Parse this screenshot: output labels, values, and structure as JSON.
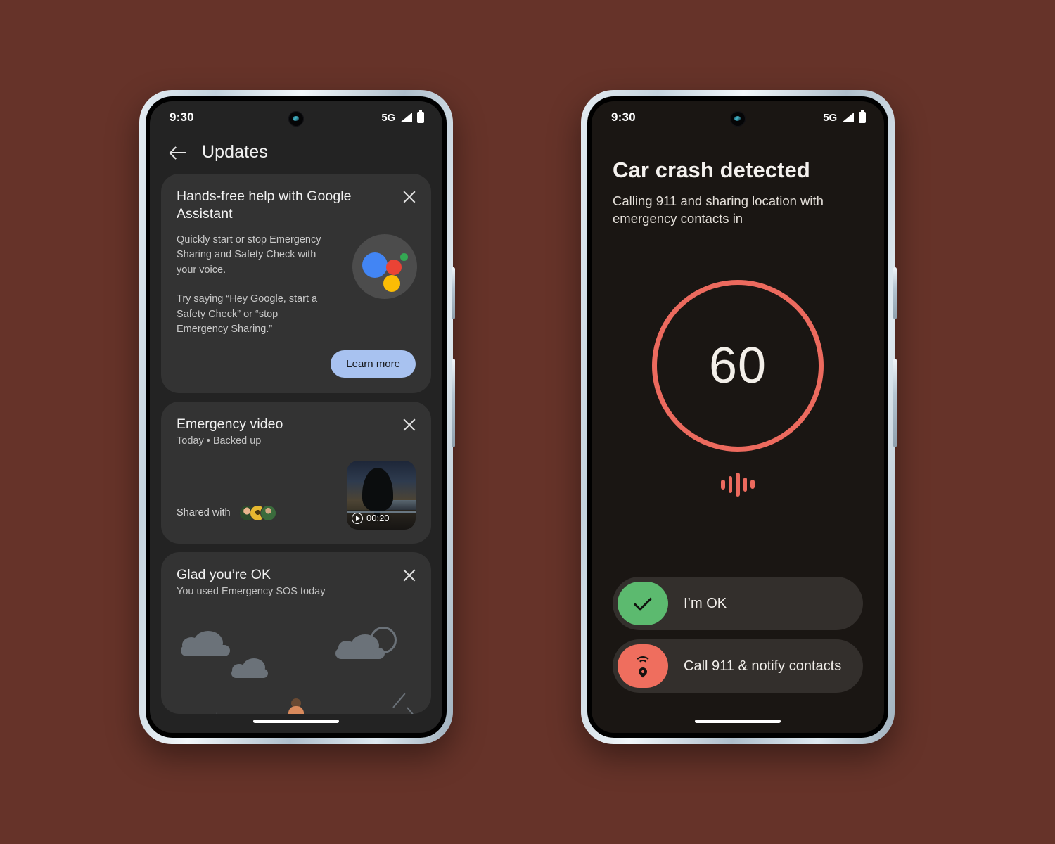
{
  "background_color": "#663329",
  "phones": {
    "left": {
      "status_bar": {
        "time": "9:30",
        "network": "5G",
        "signal_icon": "signal-bars-icon",
        "battery_icon": "battery-full-icon"
      },
      "topbar": {
        "back_icon": "back-arrow-icon",
        "title": "Updates"
      },
      "cards": [
        {
          "id": "assistant",
          "title": "Hands-free help with Google Assistant",
          "close_icon": "close-icon",
          "paragraphs": [
            "Quickly start or stop Emergency Sharing and Safety Check with your voice.",
            "Try saying “Hey Google, start a Safety Check” or “stop Emergency Sharing.”"
          ],
          "orb_icon": "google-assistant-icon",
          "button_label": "Learn more",
          "button_color": "#a8c2f0"
        },
        {
          "id": "emergency-video",
          "title": "Emergency video",
          "subtitle": "Today • Backed up",
          "close_icon": "close-icon",
          "shared_label": "Shared with",
          "avatar_count": 3,
          "thumbnail": {
            "play_icon": "play-circle-icon",
            "duration": "00:20"
          }
        },
        {
          "id": "glad-youre-ok",
          "title": "Glad you’re OK",
          "subtitle": "You used Emergency SOS today",
          "close_icon": "close-icon",
          "illustration": "clouds-sun-mountains-person-illustration"
        }
      ],
      "home_indicator": "home-indicator"
    },
    "right": {
      "status_bar": {
        "time": "9:30",
        "network": "5G",
        "signal_icon": "signal-bars-icon",
        "battery_icon": "battery-full-icon"
      },
      "title": "Car crash detected",
      "subtitle": "Calling 911 and sharing location with emergency contacts in",
      "countdown": {
        "value": "60",
        "ring_color": "#ec6a5e"
      },
      "waveform_icon": "audio-waveform-icon",
      "actions": [
        {
          "id": "im-ok",
          "label": "I’m OK",
          "icon": "check-icon",
          "color": "#5cba6f"
        },
        {
          "id": "call-911",
          "label": "Call 911 & notify contacts",
          "icon": "emergency-beacon-icon",
          "color": "#ef6e5e"
        }
      ],
      "home_indicator": "home-indicator"
    }
  }
}
